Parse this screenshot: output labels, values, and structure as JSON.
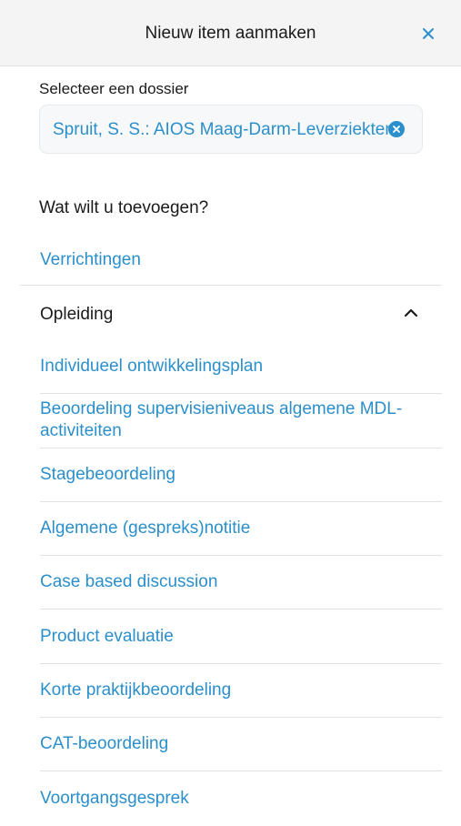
{
  "header": {
    "title": "Nieuw item aanmaken",
    "close_icon": "close-icon"
  },
  "dossier": {
    "label": "Selecteer een dossier",
    "value": "Spruit, S. S.: AIOS Maag-Darm-Leverziekten",
    "clear_icon": "clear-icon"
  },
  "question": "Wat wilt u toevoegen?",
  "top_item": "Verrichtingen",
  "section": {
    "title": "Opleiding",
    "expanded": true,
    "items": [
      "Individueel ontwikkelingsplan",
      "Beoordeling supervisieniveaus algemene MDL-activiteiten",
      "Stagebeoordeling",
      "Algemene (gespreks)notitie",
      "Case based discussion",
      "Product evaluatie",
      "Korte praktijkbeoordeling",
      "CAT-beoordeling",
      "Voortgangsgesprek"
    ]
  },
  "colors": {
    "accent": "#2b8fcb",
    "header_bg": "#f4f4f4",
    "divider": "#e2e2e2"
  }
}
